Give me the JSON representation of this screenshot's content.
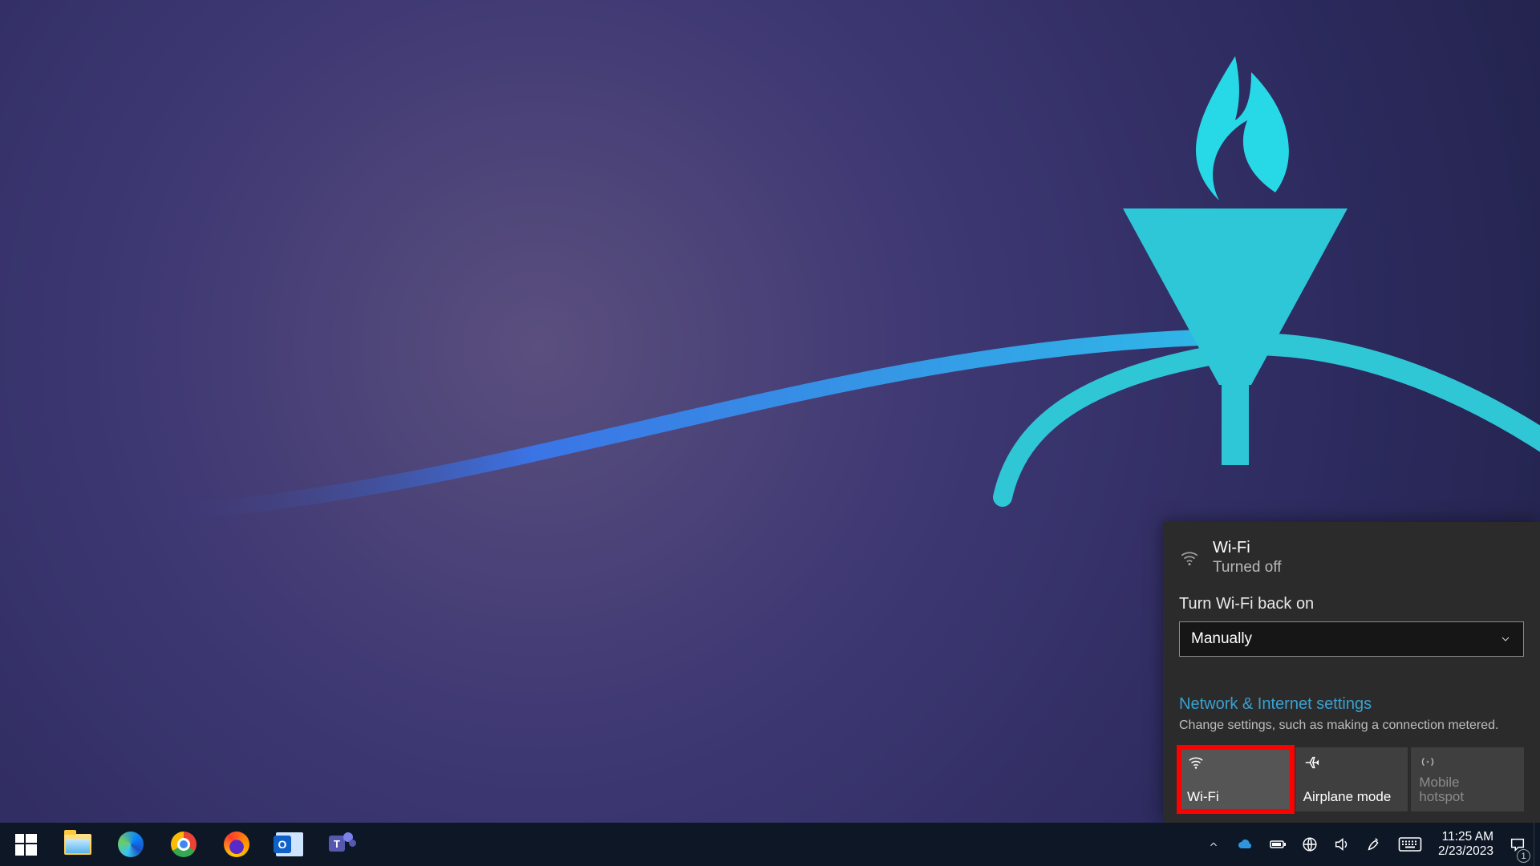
{
  "flyout": {
    "header": {
      "title": "Wi-Fi",
      "status": "Turned off"
    },
    "turn_on": {
      "label": "Turn Wi-Fi back on",
      "selected": "Manually"
    },
    "settings_link": {
      "title": "Network & Internet settings",
      "subtitle": "Change settings, such as making a connection metered."
    },
    "tiles": {
      "wifi": {
        "label": "Wi-Fi"
      },
      "air": {
        "label": "Airplane mode"
      },
      "hotspot": {
        "label_line1": "Mobile",
        "label_line2": "hotspot"
      }
    }
  },
  "taskbar": {
    "apps": {
      "start": "Start",
      "explorer": "File Explorer",
      "edge": "Microsoft Edge",
      "chrome": "Google Chrome",
      "firefox": "Firefox",
      "outlook": "Outlook",
      "teams": "Microsoft Teams"
    },
    "tray": {
      "time": "11:25 AM",
      "date": "2/23/2023",
      "action_center_count": "1"
    }
  }
}
